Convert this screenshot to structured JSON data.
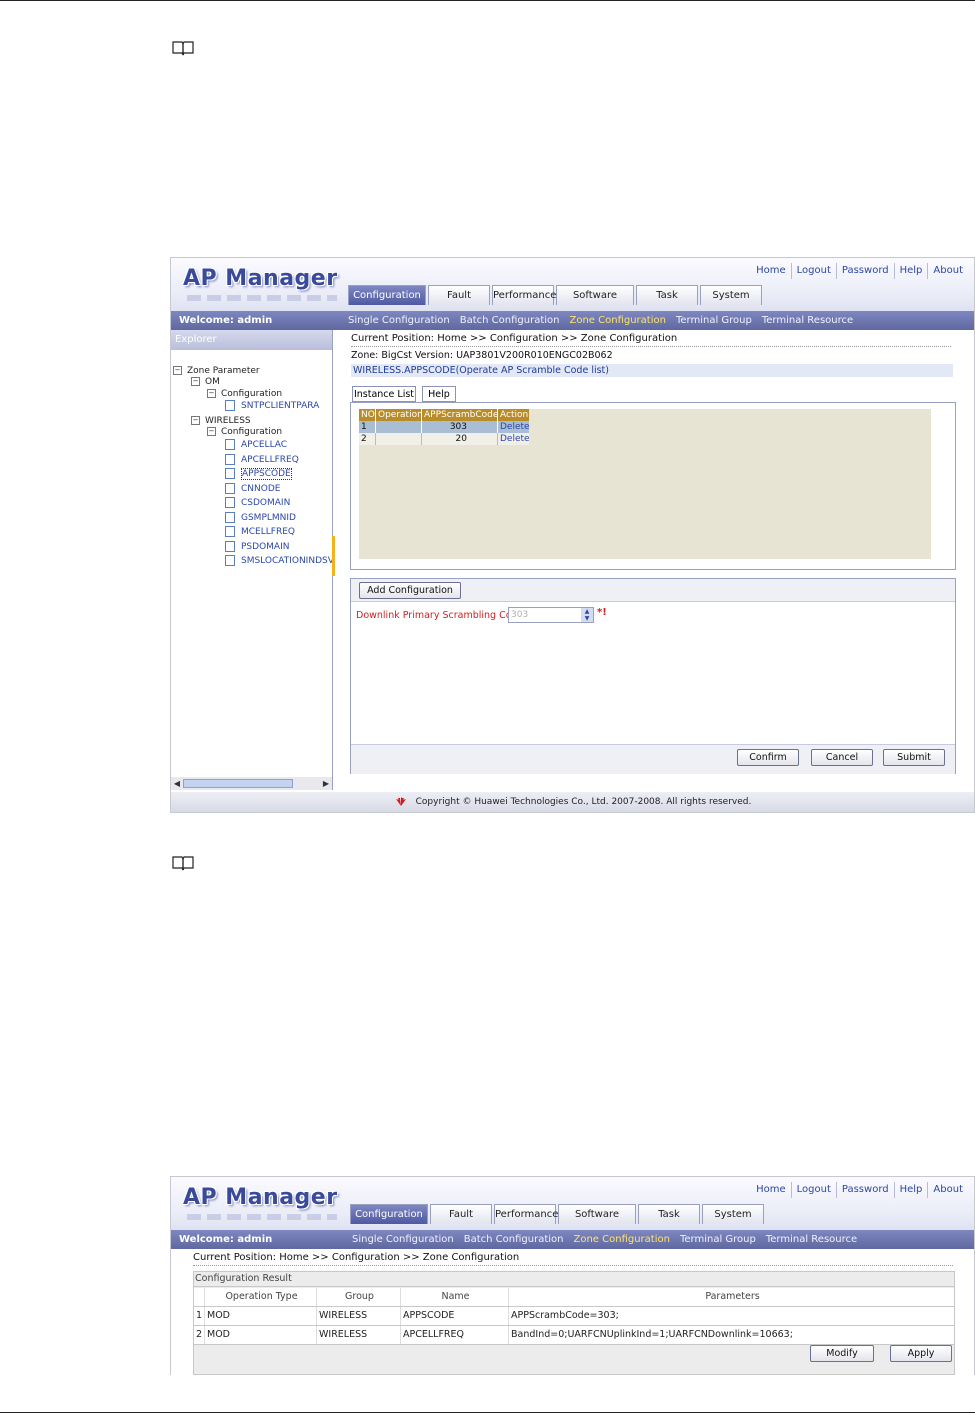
{
  "app": {
    "logo": "AP Manager",
    "top_links": [
      "Home",
      "Logout",
      "Password",
      "Help",
      "About"
    ],
    "tabs": [
      "Configuration",
      "Fault",
      "Performance",
      "Software",
      "Task",
      "System"
    ],
    "active_tab": "Configuration",
    "welcome": "Welcome: admin",
    "subnav": [
      "Single Configuration",
      "Batch Configuration",
      "Zone Configuration",
      "Terminal Group",
      "Terminal Resource"
    ],
    "subnav_current": "Zone Configuration",
    "breadcrumb": "Current Position: Home >> Configuration >> Zone Configuration"
  },
  "screen_a": {
    "explorer_title": "Explorer",
    "tree": {
      "root": "Zone Parameter",
      "om": "OM",
      "om_config": "Configuration",
      "om_items": [
        "SNTPCLIENTPARA"
      ],
      "wireless": "WIRELESS",
      "wireless_config": "Configuration",
      "wireless_items": [
        "APCELLAC",
        "APCELLFREQ",
        "APPSCODE",
        "CNNODE",
        "CSDOMAIN",
        "GSMPLMNID",
        "MCELLFREQ",
        "PSDOMAIN",
        "SMSLOCATIONINDSV"
      ],
      "selected": "APPSCODE"
    },
    "zone_info": "Zone: BigCst  Version: UAP3801V200R010ENGC02B062",
    "object_title": "WIRELESS.APPSCODE(Operate AP Scramble Code list)",
    "subtabs": [
      "Instance List",
      "Help"
    ],
    "grid": {
      "headers": [
        "NO.",
        "Operation",
        "APPScrambCode",
        "Action"
      ],
      "rows": [
        [
          "1",
          "",
          "303",
          "Delete"
        ],
        [
          "2",
          "",
          "20",
          "Delete"
        ]
      ]
    },
    "add_button": "Add Configuration",
    "field_label": "Downlink Primary Scrambling Code",
    "field_value": "303",
    "required_mark": "*!",
    "buttons": [
      "Confirm",
      "Cancel",
      "Submit"
    ],
    "footer": "Copyright © Huawei Technologies Co., Ltd. 2007-2008. All rights reserved."
  },
  "screen_b": {
    "section_title": "Configuration Result",
    "headers": [
      "Operation Type",
      "Group",
      "Name",
      "Parameters"
    ],
    "rows": [
      [
        "1",
        "MOD",
        "WIRELESS",
        "APPSCODE",
        "APPScrambCode=303;"
      ],
      [
        "2",
        "MOD",
        "WIRELESS",
        "APCELLFREQ",
        "BandInd=0;UARFCNUplinkInd=1;UARFCNDownlink=10663;"
      ]
    ],
    "buttons": [
      "Modify",
      "Apply"
    ]
  },
  "colors": {
    "navbar": "#6a73ad",
    "highlight": "#ffe36a",
    "grid_header": "#b98c2a",
    "required": "#d42020"
  }
}
